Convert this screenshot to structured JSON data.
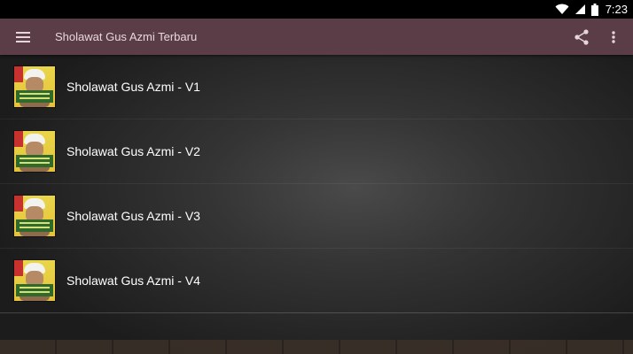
{
  "status_bar": {
    "time": "7:23"
  },
  "app_bar": {
    "title": "Sholawat Gus Azmi Terbaru",
    "background": "#5a3d47"
  },
  "icons": {
    "menu": "menu-icon",
    "share": "share-icon",
    "overflow": "more-vert-icon",
    "wifi": "wifi-icon",
    "signal": "signal-icon",
    "battery": "battery-icon"
  },
  "list": {
    "items": [
      {
        "label": "Sholawat Gus Azmi - V1"
      },
      {
        "label": "Sholawat Gus Azmi - V2"
      },
      {
        "label": "Sholawat Gus Azmi - V3"
      },
      {
        "label": "Sholawat Gus Azmi - V4"
      }
    ]
  }
}
